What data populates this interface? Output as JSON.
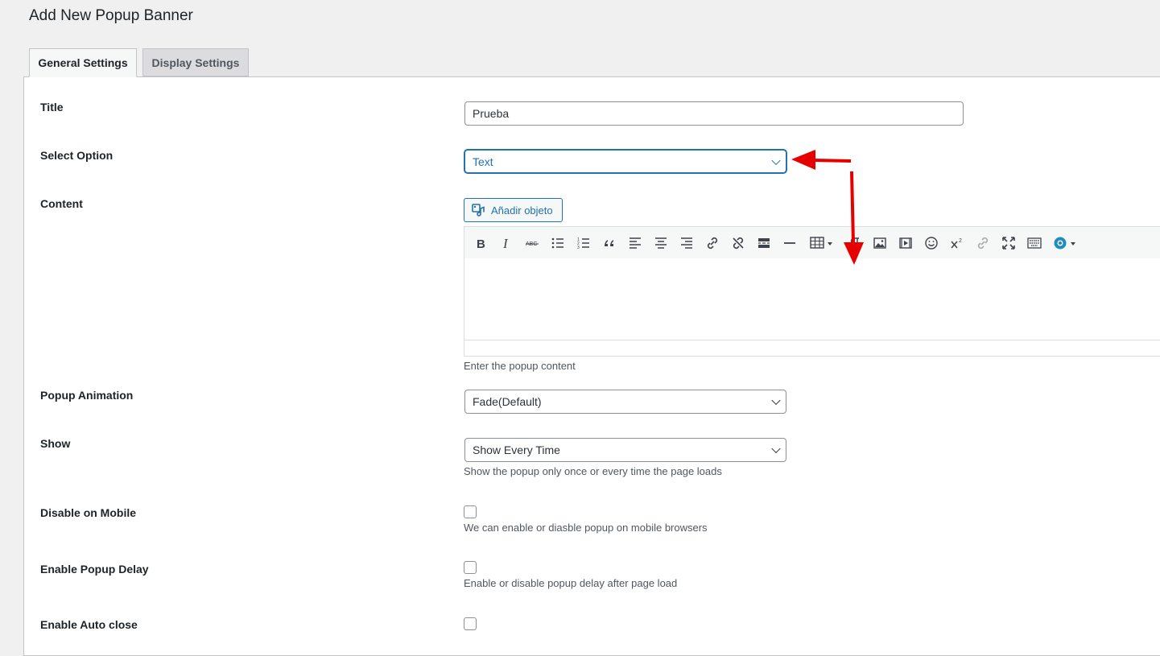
{
  "page": {
    "title": "Add New Popup Banner"
  },
  "tabs": [
    {
      "label": "General Settings",
      "active": true
    },
    {
      "label": "Display Settings",
      "active": false
    }
  ],
  "fields": {
    "title": {
      "label": "Title",
      "value": "Prueba"
    },
    "select_option": {
      "label": "Select Option",
      "value": "Text"
    },
    "content": {
      "label": "Content",
      "add_media_label": "Añadir objeto",
      "help": "Enter the popup content",
      "toolbar_icons": [
        "bold-icon",
        "italic-icon",
        "strikethrough-icon",
        "bullet-list-icon",
        "numbered-list-icon",
        "blockquote-icon",
        "align-left-icon",
        "align-center-icon",
        "align-right-icon",
        "link-icon",
        "unlink-icon",
        "read-more-icon",
        "horizontal-line-icon",
        "table-icon",
        "paragraph-icon",
        "image-icon",
        "media-icon",
        "emoji-icon",
        "superscript-icon",
        "link-alt-icon",
        "fullscreen-icon",
        "keyboard-icon",
        "plugin-icon"
      ]
    },
    "popup_animation": {
      "label": "Popup Animation",
      "value": "Fade(Default)"
    },
    "show": {
      "label": "Show",
      "value": "Show Every Time",
      "help": "Show the popup only once or every time the page loads"
    },
    "disable_mobile": {
      "label": "Disable on Mobile",
      "help": "We can enable or diasble popup on mobile browsers",
      "checked": false
    },
    "popup_delay": {
      "label": "Enable Popup Delay",
      "help": "Enable or disable popup delay after page load",
      "checked": false
    },
    "auto_close": {
      "label": "Enable Auto close",
      "checked": false
    }
  },
  "annotations": {
    "arrow_color": "#e60000"
  },
  "colors": {
    "accent": "#2271b1",
    "background": "#f0f0f1"
  }
}
